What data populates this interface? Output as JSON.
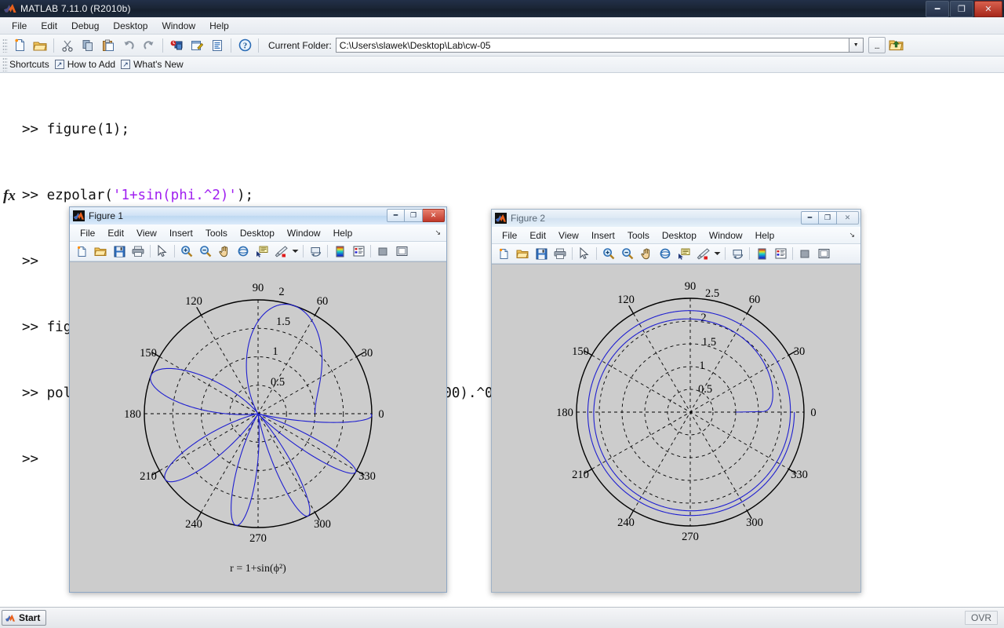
{
  "app": {
    "title": "MATLAB  7.11.0 (R2010b)",
    "window_buttons": [
      "minimize",
      "restore",
      "close"
    ]
  },
  "menubar": {
    "items": [
      "File",
      "Edit",
      "Debug",
      "Desktop",
      "Window",
      "Help"
    ]
  },
  "toolbar": {
    "buttons": [
      "new-file-icon",
      "open-folder-icon",
      "cut-icon",
      "copy-icon",
      "paste-icon",
      "undo-icon",
      "redo-icon",
      "simulink-icon",
      "guide-icon",
      "profiler-icon",
      "help-icon"
    ],
    "current_folder_label": "Current Folder:",
    "current_folder_value": "C:\\Users\\slawek\\Desktop\\Lab\\cw-05",
    "browse_label": "...",
    "up_one_level": "up-folder-icon"
  },
  "shortcuts": {
    "label": "Shortcuts",
    "items": [
      "How to Add",
      "What's New"
    ]
  },
  "command_window": {
    "prompt": ">>",
    "lines": [
      {
        "prompt": ">>",
        "pre": "figure(1);",
        "str": "",
        "post": ""
      },
      {
        "prompt": ">>",
        "pre": "ezpolar(",
        "str": "'1+sin(phi.^2)'",
        "post": ");"
      },
      {
        "prompt": ">>",
        "pre": "",
        "str": "",
        "post": ""
      },
      {
        "prompt": ">>",
        "pre": "figure(2);",
        "str": "",
        "post": ""
      },
      {
        "prompt": ">>",
        "pre": "polar(linspace(0,4*pi,1600),1+linspace(0,4*pi,1600).^0.1 );",
        "str": "",
        "post": ""
      },
      {
        "prompt": ">>",
        "pre": "",
        "str": "",
        "post": ""
      }
    ],
    "fx_symbol": "fx"
  },
  "figures": [
    {
      "id": "figure-1",
      "title": "Figure 1",
      "active": true,
      "menu": [
        "File",
        "Edit",
        "View",
        "Insert",
        "Tools",
        "Desktop",
        "Window",
        "Help"
      ],
      "toolbar_icons": [
        "new-figure-icon",
        "open-figure-icon",
        "save-figure-icon",
        "print-icon",
        "pointer-icon",
        "zoom-in-icon",
        "zoom-out-icon",
        "pan-icon",
        "rotate3d-icon",
        "data-cursor-icon",
        "brush-icon",
        "brush-dropdown-icon",
        "link-plot-icon",
        "colorbar-icon",
        "legend-icon",
        "hide-plot-tools-icon",
        "show-plot-tools-icon"
      ],
      "window_buttons": [
        "minimize",
        "maximize",
        "close"
      ],
      "caption": "r = 1+sin(ϕ²)"
    },
    {
      "id": "figure-2",
      "title": "Figure 2",
      "active": false,
      "menu": [
        "File",
        "Edit",
        "View",
        "Insert",
        "Tools",
        "Desktop",
        "Window",
        "Help"
      ],
      "toolbar_icons": [
        "new-figure-icon",
        "open-figure-icon",
        "save-figure-icon",
        "print-icon",
        "pointer-icon",
        "zoom-in-icon",
        "zoom-out-icon",
        "pan-icon",
        "rotate3d-icon",
        "data-cursor-icon",
        "brush-icon",
        "brush-dropdown-icon",
        "link-plot-icon",
        "colorbar-icon",
        "legend-icon",
        "hide-plot-tools-icon",
        "show-plot-tools-icon"
      ],
      "window_buttons": [
        "minimize",
        "maximize",
        "close"
      ],
      "caption": ""
    }
  ],
  "statusbar": {
    "start_label": "Start",
    "overwrite_label": "OVR"
  },
  "colors": {
    "curve": "#1f1fd0",
    "axis": "#000000",
    "grid": "#000000",
    "figure_bg": "#cccccc",
    "axes_bg": "#ffffff",
    "string_literal": "#a020f0",
    "titlebar": "#1b2636"
  },
  "chart_data": [
    {
      "id": "figure-1-polar",
      "type": "line",
      "coordinate_system": "polar",
      "title": "",
      "caption": "r = 1+sin(ϕ²)",
      "equation": "r = 1 + sin(phi.^2)",
      "command": "ezpolar('1+sin(phi.^2)')",
      "theta_unit": "degrees",
      "theta_ticks": [
        0,
        30,
        60,
        90,
        120,
        150,
        180,
        210,
        240,
        270,
        300,
        330
      ],
      "theta_tick_labels": [
        "0",
        "30",
        "60",
        "90",
        "120",
        "150",
        "180",
        "210",
        "240",
        "270",
        "300",
        "330"
      ],
      "r_ticks": [
        0.5,
        1,
        1.5,
        2
      ],
      "r_tick_labels": [
        "0.5",
        "1",
        "1.5",
        "2"
      ],
      "rlim": [
        0,
        2
      ],
      "theta_range_rad": [
        0,
        6.283185307179586
      ],
      "n_points": 1200,
      "grid": true,
      "legend": false,
      "line_color": "#1f1fd0",
      "line_width": 1
    },
    {
      "id": "figure-2-polar",
      "type": "line",
      "coordinate_system": "polar",
      "title": "",
      "caption": "",
      "equation": "r = 1 + theta.^0.1",
      "command": "polar(linspace(0,4*pi,1600),1+linspace(0,4*pi,1600).^0.1 )",
      "theta_unit": "degrees",
      "theta_ticks": [
        0,
        30,
        60,
        90,
        120,
        150,
        180,
        210,
        240,
        270,
        300,
        330
      ],
      "theta_tick_labels": [
        "0",
        "30",
        "60",
        "90",
        "120",
        "150",
        "180",
        "210",
        "240",
        "270",
        "300",
        "330"
      ],
      "r_ticks": [
        0.5,
        1,
        1.5,
        2,
        2.5
      ],
      "r_tick_labels": [
        "0.5",
        "1",
        "1.5",
        "2",
        "2.5"
      ],
      "rlim": [
        0,
        2.5
      ],
      "theta_range_rad": [
        0,
        12.566370614359172
      ],
      "n_points": 1600,
      "grid": true,
      "legend": false,
      "line_color": "#1f1fd0",
      "line_width": 1
    }
  ]
}
